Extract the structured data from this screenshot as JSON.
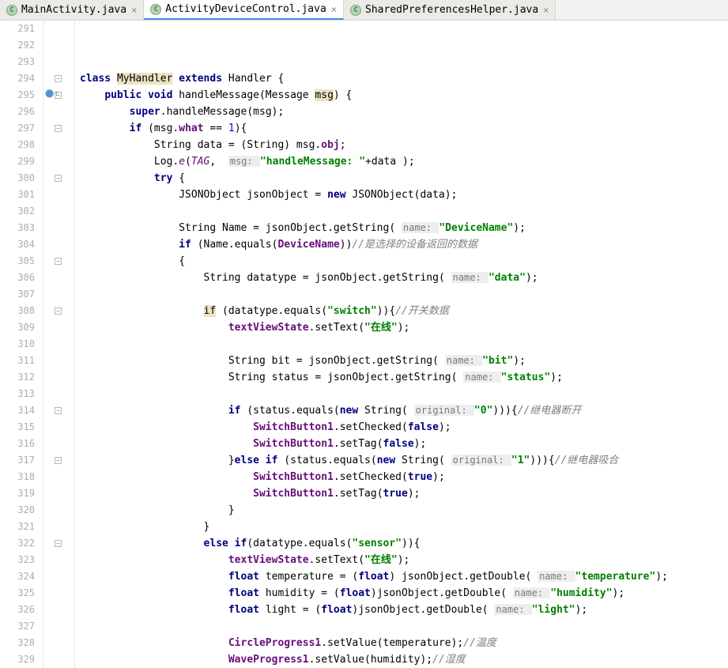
{
  "tabs": [
    {
      "label": "MainActivity.java",
      "active": false
    },
    {
      "label": "ActivityDeviceControl.java",
      "active": true
    },
    {
      "label": "SharedPreferencesHelper.java",
      "active": false
    }
  ],
  "startLine": 291,
  "lines": [
    {
      "n": 291,
      "t": ""
    },
    {
      "n": 292,
      "t": ""
    },
    {
      "n": 293,
      "t": ""
    },
    {
      "n": 294,
      "tokens": [
        [
          "kw",
          "class "
        ],
        [
          "hl",
          "MyHandler"
        ],
        [
          "kw",
          " extends "
        ],
        [
          "",
          "Handler {"
        ]
      ]
    },
    {
      "n": 295,
      "tokens": [
        [
          "",
          "    "
        ],
        [
          "kw",
          "public void "
        ],
        [
          "",
          "handleMessage(Message "
        ],
        [
          "hl",
          "msg"
        ],
        [
          "",
          ") {"
        ]
      ]
    },
    {
      "n": 296,
      "tokens": [
        [
          "",
          "        "
        ],
        [
          "kw",
          "super"
        ],
        [
          "",
          ".handleMessage(msg);"
        ]
      ]
    },
    {
      "n": 297,
      "tokens": [
        [
          "",
          "        "
        ],
        [
          "kw",
          "if "
        ],
        [
          "",
          "(msg."
        ],
        [
          "field",
          "what"
        ],
        [
          "",
          ""
        ],
        [
          "",
          ""
        ],
        [
          "",
          ""
        ],
        [
          "",
          ""
        ],
        [
          "",
          ""
        ],
        [
          "",
          ""
        ],
        [
          "",
          ""
        ],
        [
          "",
          ""
        ],
        [
          "",
          ""
        ],
        [
          "",
          ""
        ],
        [
          "",
          ""
        ],
        [
          "",
          ""
        ],
        [
          "",
          ""
        ],
        [
          "",
          " == "
        ],
        [
          "num",
          "1"
        ],
        [
          "",
          "){"
        ]
      ]
    },
    {
      "n": 298,
      "tokens": [
        [
          "",
          "            String data = (String) msg."
        ],
        [
          "field",
          "obj"
        ],
        [
          "",
          ";"
        ]
      ]
    },
    {
      "n": 299,
      "tokens": [
        [
          "",
          "            Log."
        ],
        [
          "staticfield",
          "e"
        ],
        [
          "",
          "("
        ],
        [
          "staticfield",
          "TAG"
        ],
        [
          "",
          ",  "
        ],
        [
          "hint",
          "msg: "
        ],
        [
          "str",
          "\"handleMessage: \""
        ],
        [
          "",
          "+data );"
        ]
      ]
    },
    {
      "n": 300,
      "tokens": [
        [
          "",
          "            "
        ],
        [
          "kw",
          "try "
        ],
        [
          "",
          "{"
        ]
      ]
    },
    {
      "n": 301,
      "tokens": [
        [
          "",
          "                JSONObject jsonObject = "
        ],
        [
          "kw",
          "new "
        ],
        [
          "",
          "JSONObject(data);"
        ]
      ]
    },
    {
      "n": 302,
      "t": ""
    },
    {
      "n": 303,
      "tokens": [
        [
          "",
          "                String Name = jsonObject.getString( "
        ],
        [
          "hint",
          "name: "
        ],
        [
          "str",
          "\"DeviceName\""
        ],
        [
          "",
          ");"
        ]
      ]
    },
    {
      "n": 304,
      "tokens": [
        [
          "",
          "                "
        ],
        [
          "kw",
          "if "
        ],
        [
          "",
          "(Name.equals("
        ],
        [
          "field",
          "DeviceName"
        ],
        [
          "",
          "))"
        ],
        [
          "com",
          "//是选择的设备返回的数据"
        ]
      ]
    },
    {
      "n": 305,
      "tokens": [
        [
          "",
          "                {"
        ]
      ]
    },
    {
      "n": 306,
      "tokens": [
        [
          "",
          "                    String datatype = jsonObject.getString( "
        ],
        [
          "hint",
          "name: "
        ],
        [
          "str",
          "\"data\""
        ],
        [
          "",
          ");"
        ]
      ]
    },
    {
      "n": 307,
      "t": ""
    },
    {
      "n": 308,
      "tokens": [
        [
          "",
          "                    "
        ],
        [
          "hl",
          "if"
        ],
        [
          "",
          ""
        ],
        [
          "",
          " (datatype.equals("
        ],
        [
          "str",
          "\"switch\""
        ],
        [
          "",
          ")){"
        ],
        [
          "com",
          "//开关数据"
        ]
      ]
    },
    {
      "n": 309,
      "tokens": [
        [
          "",
          "                        "
        ],
        [
          "field",
          "textViewState"
        ],
        [
          "",
          ".setText("
        ],
        [
          "str",
          "\"在线\""
        ],
        [
          "",
          ");"
        ]
      ]
    },
    {
      "n": 310,
      "t": ""
    },
    {
      "n": 311,
      "tokens": [
        [
          "",
          "                        String bit = jsonObject.getString( "
        ],
        [
          "hint",
          "name: "
        ],
        [
          "str",
          "\"bit\""
        ],
        [
          "",
          ");"
        ]
      ]
    },
    {
      "n": 312,
      "tokens": [
        [
          "",
          "                        String status = jsonObject.getString( "
        ],
        [
          "hint",
          "name: "
        ],
        [
          "str",
          "\"status\""
        ],
        [
          "",
          ");"
        ]
      ]
    },
    {
      "n": 313,
      "t": ""
    },
    {
      "n": 314,
      "tokens": [
        [
          "",
          "                        "
        ],
        [
          "kw",
          "if "
        ],
        [
          "",
          "(status.equals("
        ],
        [
          "kw",
          "new "
        ],
        [
          "",
          "String( "
        ],
        [
          "hint",
          "original: "
        ],
        [
          "str",
          "\"0\""
        ],
        [
          "",
          "))){"
        ],
        [
          "com",
          "//继电器断开"
        ]
      ]
    },
    {
      "n": 315,
      "tokens": [
        [
          "",
          "                            "
        ],
        [
          "field",
          "SwitchButton1"
        ],
        [
          "",
          ".setChecked("
        ],
        [
          "kw",
          "false"
        ],
        [
          "",
          ");"
        ]
      ]
    },
    {
      "n": 316,
      "tokens": [
        [
          "",
          "                            "
        ],
        [
          "field",
          "SwitchButton1"
        ],
        [
          "",
          ".setTag("
        ],
        [
          "kw",
          "false"
        ],
        [
          "",
          ");"
        ]
      ]
    },
    {
      "n": 317,
      "tokens": [
        [
          "",
          "                        }"
        ],
        [
          "kw",
          "else if "
        ],
        [
          "",
          "(status.equals("
        ],
        [
          "kw",
          "new "
        ],
        [
          "",
          "String( "
        ],
        [
          "hint",
          "original: "
        ],
        [
          "str",
          "\"1\""
        ],
        [
          "",
          "))){"
        ],
        [
          "com",
          "//继电器吸合"
        ]
      ]
    },
    {
      "n": 318,
      "tokens": [
        [
          "",
          "                            "
        ],
        [
          "field",
          "SwitchButton1"
        ],
        [
          "",
          ".setChecked("
        ],
        [
          "kw",
          "true"
        ],
        [
          "",
          ");"
        ]
      ]
    },
    {
      "n": 319,
      "tokens": [
        [
          "",
          "                            "
        ],
        [
          "field",
          "SwitchButton1"
        ],
        [
          "",
          ".setTag("
        ],
        [
          "kw",
          "true"
        ],
        [
          "",
          ");"
        ]
      ]
    },
    {
      "n": 320,
      "tokens": [
        [
          "",
          "                        }"
        ]
      ]
    },
    {
      "n": 321,
      "tokens": [
        [
          "",
          "                    }"
        ]
      ]
    },
    {
      "n": 322,
      "tokens": [
        [
          "",
          "                    "
        ],
        [
          "kw",
          "else if"
        ],
        [
          "",
          "(datatype.equals("
        ],
        [
          "str",
          "\"sensor\""
        ],
        [
          "",
          ")){"
        ]
      ]
    },
    {
      "n": 323,
      "tokens": [
        [
          "",
          "                        "
        ],
        [
          "field",
          "textViewState"
        ],
        [
          "",
          ".setText("
        ],
        [
          "str",
          "\"在线\""
        ],
        [
          "",
          ");"
        ]
      ]
    },
    {
      "n": 324,
      "tokens": [
        [
          "",
          "                        "
        ],
        [
          "kw",
          "float "
        ],
        [
          "",
          "temperature = ("
        ],
        [
          "kw",
          "float"
        ],
        [
          "",
          ") jsonObject.getDouble( "
        ],
        [
          "hint",
          "name: "
        ],
        [
          "str",
          "\"temperature\""
        ],
        [
          "",
          ");"
        ]
      ]
    },
    {
      "n": 325,
      "tokens": [
        [
          "",
          "                        "
        ],
        [
          "kw",
          "float "
        ],
        [
          "",
          "humidity = ("
        ],
        [
          "kw",
          "float"
        ],
        [
          "",
          ")jsonObject.getDouble( "
        ],
        [
          "hint",
          "name: "
        ],
        [
          "str",
          "\"humidity\""
        ],
        [
          "",
          ");"
        ]
      ]
    },
    {
      "n": 326,
      "tokens": [
        [
          "",
          "                        "
        ],
        [
          "kw",
          "float "
        ],
        [
          "",
          "light = ("
        ],
        [
          "kw",
          "float"
        ],
        [
          "",
          ")jsonObject.getDouble( "
        ],
        [
          "hint",
          "name: "
        ],
        [
          "str",
          "\"light\""
        ],
        [
          "",
          ");"
        ]
      ]
    },
    {
      "n": 327,
      "t": ""
    },
    {
      "n": 328,
      "tokens": [
        [
          "",
          "                        "
        ],
        [
          "field",
          "CircleProgress1"
        ],
        [
          "",
          ".setValue(temperature);"
        ],
        [
          "com",
          "//温度"
        ]
      ]
    },
    {
      "n": 329,
      "tokens": [
        [
          "",
          "                        "
        ],
        [
          "field",
          "WaveProgress1"
        ],
        [
          "",
          ".setValue(humidity);"
        ],
        [
          "com",
          "//湿度"
        ]
      ]
    }
  ],
  "foldMarks": [
    294,
    295,
    297,
    300,
    305,
    308,
    314,
    317,
    322
  ],
  "overrideLine": 295
}
